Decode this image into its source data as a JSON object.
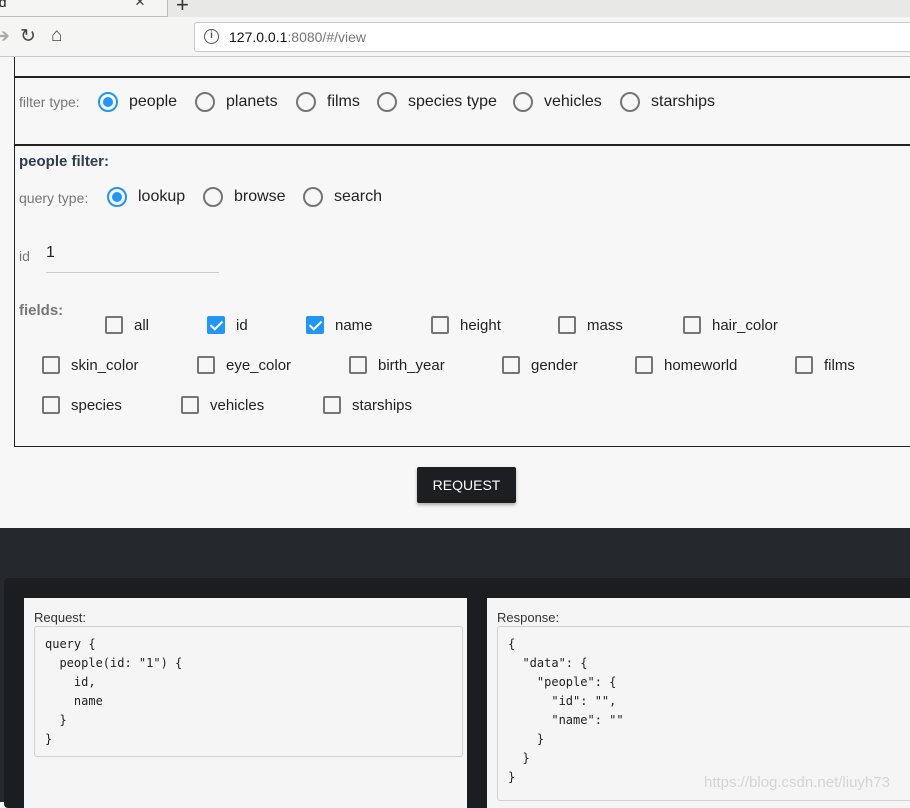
{
  "browser": {
    "tab_title": "nd",
    "url_host": "127.0.0.1",
    "url_rest": ":8080/#/view"
  },
  "filter_type": {
    "label": "filter type:",
    "options": [
      "people",
      "planets",
      "films",
      "species type",
      "vehicles",
      "starships"
    ],
    "selected": "people"
  },
  "people_filter": {
    "title": "people filter:",
    "query_label": "query type:",
    "query_options": [
      "lookup",
      "browse",
      "search"
    ],
    "selected": "lookup",
    "id_label": "id",
    "id_value": "1",
    "fields_label": "fields:",
    "fields": [
      {
        "name": "all",
        "checked": false
      },
      {
        "name": "id",
        "checked": true
      },
      {
        "name": "name",
        "checked": true
      },
      {
        "name": "height",
        "checked": false
      },
      {
        "name": "mass",
        "checked": false
      },
      {
        "name": "hair_color",
        "checked": false
      },
      {
        "name": "skin_color",
        "checked": false
      },
      {
        "name": "eye_color",
        "checked": false
      },
      {
        "name": "birth_year",
        "checked": false
      },
      {
        "name": "gender",
        "checked": false
      },
      {
        "name": "homeworld",
        "checked": false
      },
      {
        "name": "films",
        "checked": false
      },
      {
        "name": "species",
        "checked": false
      },
      {
        "name": "vehicles",
        "checked": false
      },
      {
        "name": "starships",
        "checked": false
      }
    ]
  },
  "request_button": "REQUEST",
  "request": {
    "label": "Request:",
    "code": "query {\n  people(id: \"1\") {\n    id,\n    name\n  }\n}"
  },
  "response": {
    "label": "Response:",
    "code": "{\n  \"data\": {\n    \"people\": {\n      \"id\": \"\",\n      \"name\": \"\"\n    }\n  }\n}"
  },
  "watermark": "https://blog.csdn.net/liuyh73",
  "colors": {
    "accent": "#2196f3",
    "dark_bg": "#25282c"
  }
}
